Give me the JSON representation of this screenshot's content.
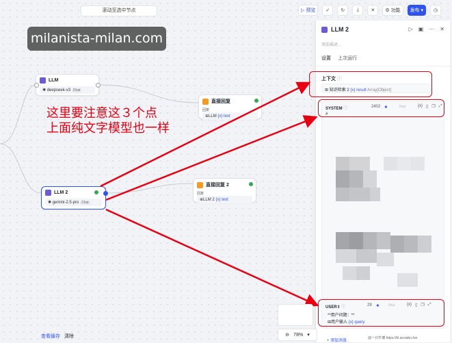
{
  "canvas": {
    "scroll_hint": "滚动至选中节点",
    "watermark": "milanista-milan.com",
    "bottom_left": {
      "view_cache": "查看缓存",
      "clear": "清除"
    },
    "zoom": {
      "value": "78%"
    }
  },
  "toolbar": {
    "preview": "▷ 预览",
    "features": "功能",
    "publish": "发布"
  },
  "nodes": {
    "llm1": {
      "title": "LLM",
      "model": "deepseek-v3",
      "model_tag": "Chat"
    },
    "reply1": {
      "title": "直接回复",
      "label": "回复",
      "var": "LLM",
      "value": "{x} text"
    },
    "llm2": {
      "title": "LLM 2",
      "model": "gemini-2.5-pro",
      "model_tag": "Chat"
    },
    "reply2": {
      "title": "直接回复 2",
      "label": "回复",
      "var": "LLM 2",
      "value": "{x} text"
    }
  },
  "annotation": {
    "line1": "这里要注意这３个点",
    "line2": "上面纯文字模型也一样"
  },
  "panel": {
    "title": "LLM 2",
    "description": "添加描述...",
    "tabs": [
      "设置",
      "上次运行"
    ],
    "context": {
      "label": "上下文",
      "var_node": "知识检索 2",
      "var_name": "{x} result",
      "var_type": "Array[Object]"
    },
    "system": {
      "label": "SYSTEM",
      "count": "2402",
      "jinja": "Jinja",
      "first_line": "#"
    },
    "user": {
      "role": "USER",
      "count": "29",
      "jinja": "Jinja",
      "line1": "**用户问题：**",
      "chip_node": "用户输入",
      "chip_var": "{x} query"
    },
    "add_message": "+ 添加消息"
  },
  "footer_watermark": "@一只牛博 https://hi.acowbo.fun"
}
